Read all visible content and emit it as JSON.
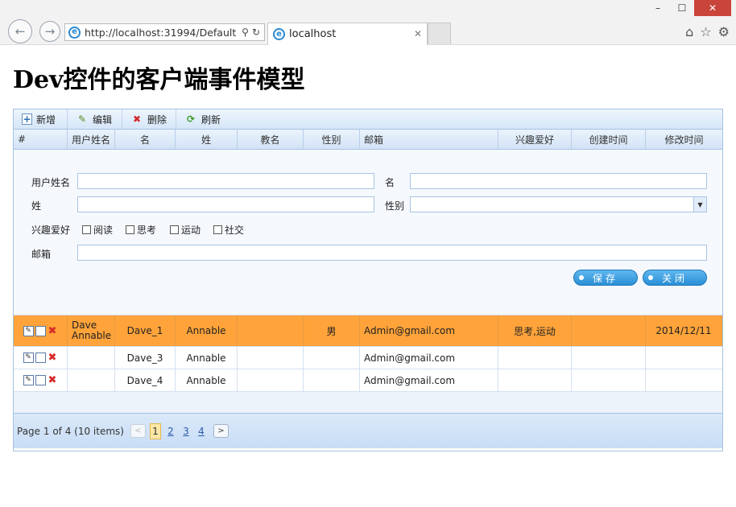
{
  "browser": {
    "address": "http://localhost:31994/Default",
    "tab_title": "localhost",
    "min_label": "–",
    "max_label": "☐",
    "close_label": "✕",
    "back_glyph": "←",
    "forward_glyph": "→",
    "search_glyph": "⚲",
    "refresh_glyph": "↻",
    "tab_close_glyph": "✕",
    "home_glyph": "⌂",
    "fav_glyph": "☆",
    "settings_glyph": "⚙"
  },
  "page": {
    "title": "Dev控件的客户端事件模型"
  },
  "toolbar": {
    "items": [
      {
        "label": "新增",
        "icon": "add-icon",
        "glyph": "+"
      },
      {
        "label": "编辑",
        "icon": "pencil-icon",
        "glyph": "✎"
      },
      {
        "label": "删除",
        "icon": "delete-icon",
        "glyph": "✖"
      },
      {
        "label": "刷新",
        "icon": "refresh-icon",
        "glyph": "⟳"
      }
    ]
  },
  "columns": [
    "#",
    "用户姓名",
    "名",
    "姓",
    "教名",
    "性别",
    "邮箱",
    "兴趣爱好",
    "创建时间",
    "修改时间"
  ],
  "form": {
    "username_label": "用户姓名",
    "username_value": "",
    "first_label": "名",
    "first_value": "",
    "last_label": "姓",
    "last_value": "",
    "gender_label": "性别",
    "gender_value": "",
    "dropdown_glyph": "▼",
    "hobby_label": "兴趣爱好",
    "hobbies": [
      "阅读",
      "思考",
      "运动",
      "社交"
    ],
    "email_label": "邮箱",
    "email_value": "",
    "save_label": "保存",
    "close_label": "关闭"
  },
  "rows": [
    {
      "username_line1": "Dave",
      "username_line2": "Annable",
      "first": "Dave_1",
      "last": "Annable",
      "christian": "",
      "gender": "男",
      "email": "Admin@gmail.com",
      "hobby": "思考,运动",
      "created": "",
      "modified": "2014/12/11",
      "selected": true
    },
    {
      "username_line1": "",
      "username_line2": "",
      "first": "Dave_3",
      "last": "Annable",
      "christian": "",
      "gender": "",
      "email": "Admin@gmail.com",
      "hobby": "",
      "created": "",
      "modified": "",
      "selected": false
    },
    {
      "username_line1": "",
      "username_line2": "",
      "first": "Dave_4",
      "last": "Annable",
      "christian": "",
      "gender": "",
      "email": "Admin@gmail.com",
      "hobby": "",
      "created": "",
      "modified": "",
      "selected": false
    }
  ],
  "row_icons": {
    "edit": "✎",
    "new": "",
    "delete": "✖"
  },
  "pager": {
    "summary": "Page 1 of 4 (10 items)",
    "prev_glyph": "<",
    "next_glyph": ">",
    "pages": [
      "1",
      "2",
      "3",
      "4"
    ],
    "current_page": "1"
  },
  "colors": {
    "selected_row": "#ffa33a",
    "accent": "#2a8fd6",
    "close_button": "#c9453b"
  }
}
